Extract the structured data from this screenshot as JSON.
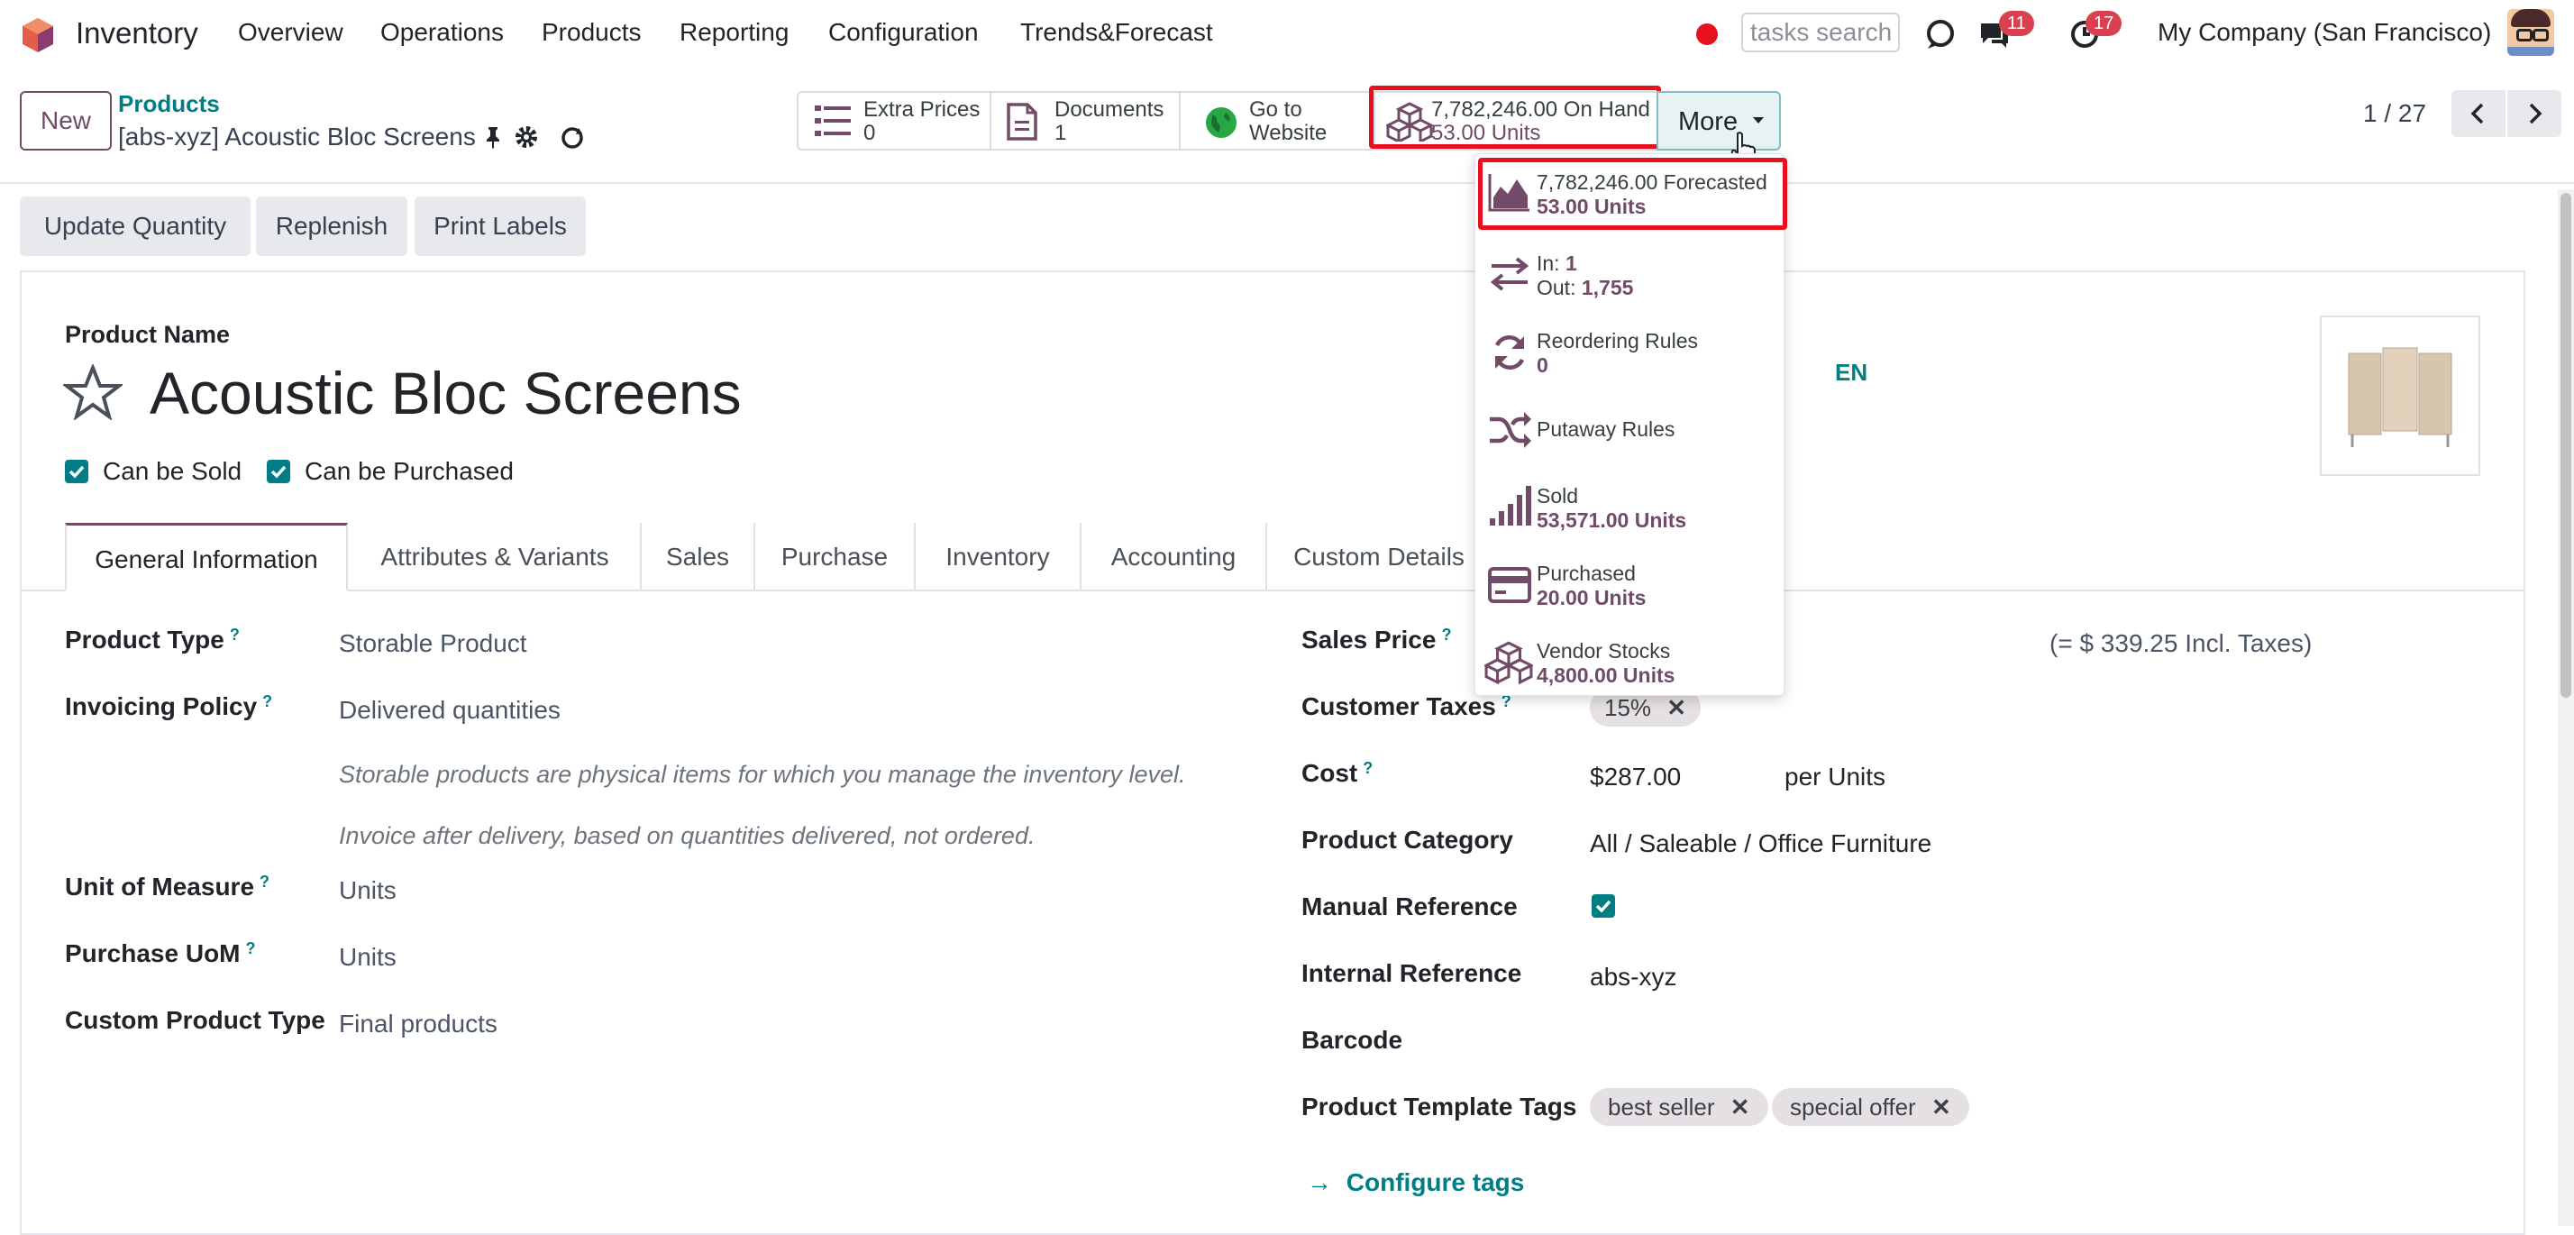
{
  "nav": {
    "brand": "Inventory",
    "items": [
      "Overview",
      "Operations",
      "Products",
      "Reporting",
      "Configuration",
      "Trends&Forecast"
    ],
    "tasks_placeholder": "tasks search",
    "messages_count": "11",
    "activities_count": "17",
    "company": "My Company (San Francisco)"
  },
  "control": {
    "new_label": "New",
    "breadcrumb_parent": "Products",
    "record_title": "[abs-xyz] Acoustic Bloc Screens",
    "pager": "1 / 27",
    "stats": {
      "extra_prices_label": "Extra Prices",
      "extra_prices_value": "0",
      "documents_label": "Documents",
      "documents_value": "1",
      "website_line1": "Go to",
      "website_line2": "Website",
      "on_hand_label": "7,782,246.00 On Hand",
      "on_hand_value": "53.00 Units",
      "more_label": "More"
    }
  },
  "dropdown": {
    "forecasted_label": "7,782,246.00 Forecasted",
    "forecasted_value": "53.00 Units",
    "in_label": "In:",
    "in_value": "1",
    "out_label": "Out:",
    "out_value": "1,755",
    "reordering_label": "Reordering Rules",
    "reordering_value": "0",
    "putaway_label": "Putaway Rules",
    "sold_label": "Sold",
    "sold_value": "53,571.00 Units",
    "purchased_label": "Purchased",
    "purchased_value": "20.00 Units",
    "vendor_label": "Vendor Stocks",
    "vendor_value": "4,800.00 Units"
  },
  "actions": [
    "Update Quantity",
    "Replenish",
    "Print Labels"
  ],
  "form": {
    "product_name_label": "Product Name",
    "product_name": "Acoustic Bloc Screens",
    "lang": "EN",
    "can_be_sold": "Can be Sold",
    "can_be_purchased": "Can be Purchased",
    "tabs": [
      "General Information",
      "Attributes & Variants",
      "Sales",
      "Purchase",
      "Inventory",
      "Accounting",
      "Custom Details"
    ],
    "left": {
      "product_type_label": "Product Type",
      "product_type": "Storable Product",
      "invoicing_policy_label": "Invoicing Policy",
      "invoicing_policy": "Delivered quantities",
      "note1": "Storable products are physical items for which you manage the inventory level.",
      "note2": "Invoice after delivery, based on quantities delivered, not ordered.",
      "uom_label": "Unit of Measure",
      "uom": "Units",
      "purchase_uom_label": "Purchase UoM",
      "purchase_uom": "Units",
      "custom_type_label": "Custom Product Type",
      "custom_type": "Final products"
    },
    "right": {
      "sales_price_label": "Sales Price",
      "sales_price_incl": "(= $ 339.25 Incl. Taxes)",
      "customer_taxes_label": "Customer Taxes",
      "customer_tax": "15%",
      "cost_label": "Cost",
      "cost": "$287.00",
      "cost_unit": "per Units",
      "category_label": "Product Category",
      "category": "All / Saleable / Office Furniture",
      "manual_ref_label": "Manual Reference",
      "internal_ref_label": "Internal Reference",
      "internal_ref": "abs-xyz",
      "barcode_label": "Barcode",
      "tags_label": "Product Template Tags",
      "tags": [
        "best seller",
        "special offer"
      ],
      "configure_tags": "Configure tags"
    }
  },
  "colors": {
    "accent": "#714b67",
    "teal": "#017e84",
    "highlight": "#e8101e",
    "badge": "#d9414f"
  }
}
